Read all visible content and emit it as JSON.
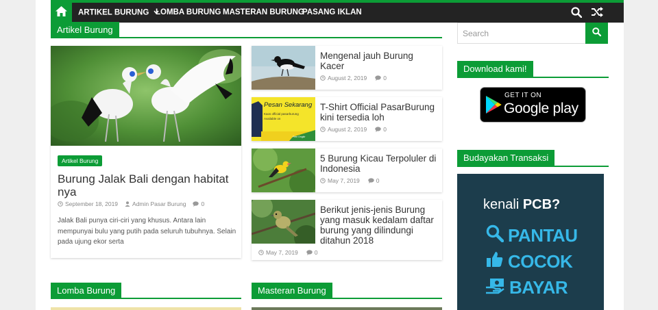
{
  "nav": {
    "items": [
      "ARTIKEL BURUNG",
      "LOMBA BURUNG",
      "MASTERAN BURUNG",
      "PASANG IKLAN"
    ]
  },
  "sections": {
    "artikel": "Artikel Burung",
    "lomba": "Lomba Burung",
    "masteran": "Masteran Burung"
  },
  "featured": {
    "category": "Artikel Burung",
    "title": "Burung Jalak Bali dengan habitat nya",
    "date": "September 18, 2019",
    "author": "Admin Pasar Burung",
    "comments": "0",
    "excerpt": "Jalak Bali punya ciri-ciri yang khusus. Antara lain mempunyai bulu yang putih pada seluruh tubuhnya. Selain pada ujung ekor serta"
  },
  "posts": [
    {
      "title": "Mengenal jauh Burung Kacer",
      "date": "August 2, 2019",
      "comments": "0"
    },
    {
      "title": "T-Shirt Official PasarBurung kini tersedia loh",
      "date": "August 2, 2019",
      "comments": "0"
    },
    {
      "title": "5 Burung Kicau Terpoluler di Indonesia",
      "date": "May 7, 2019",
      "comments": "0"
    },
    {
      "title": "Berikut jenis-jenis Burung yang masuk kedalam daftar burung  yang dilindungi ditahun 2018",
      "date": "May 7, 2019",
      "comments": "0"
    }
  ],
  "tshirt_thumb": {
    "headline": "Pesan Sekarang",
    "line1": "Kaos official pasarburung",
    "line2": "Available on",
    "line3": "Free Ongkir"
  },
  "sidebar": {
    "search_placeholder": "Search",
    "download_title": "Download kami!",
    "gplay_small": "GET IT ON",
    "gplay_big": "Google play",
    "budaya_title": "Budayakan Transaksi",
    "pcb_kenali": "kenali",
    "pcb_brand": "PCB?",
    "pcb_words": [
      "PANTAU",
      "COCOK",
      "BAYAR"
    ]
  },
  "colors": {
    "accent": "#0c9c36",
    "nav_bg": "#232323",
    "pcb_bg": "#1c3d4c",
    "pcb_text": "#36b8e8"
  }
}
